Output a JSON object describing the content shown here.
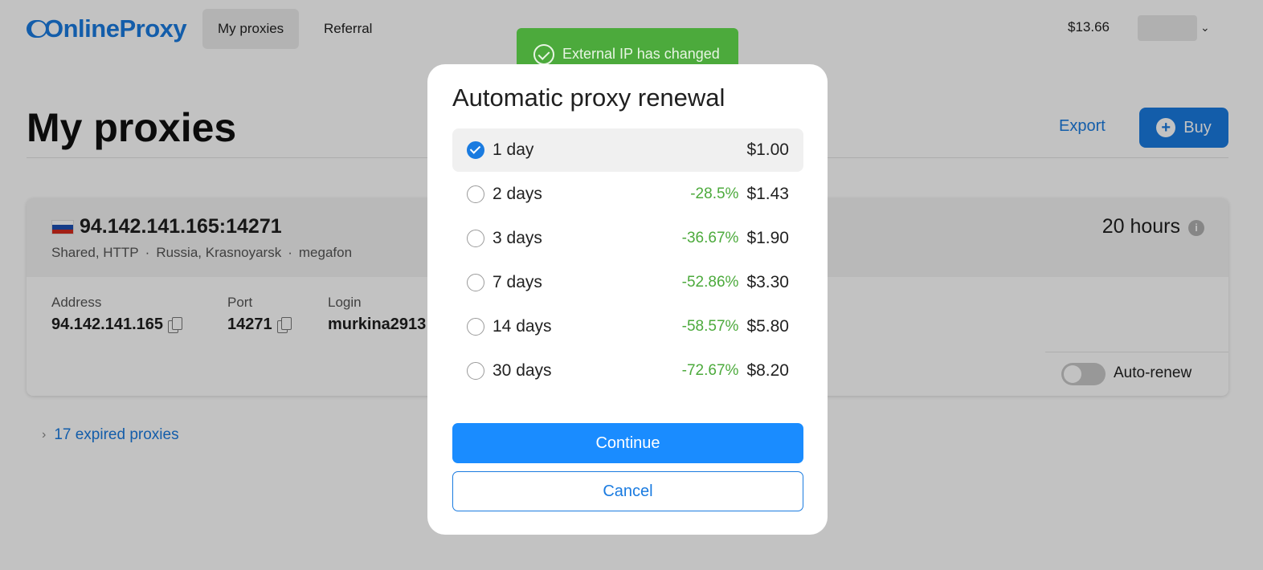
{
  "header": {
    "logo_text": "OnlineProxy",
    "nav": [
      {
        "label": "My proxies",
        "active": true
      },
      {
        "label": "Referral",
        "active": false
      }
    ],
    "balance": "$13.66",
    "user_menu_icon": "chevron-down-icon"
  },
  "page": {
    "title": "My proxies",
    "export_label": "Export",
    "buy_label": "Buy"
  },
  "proxy": {
    "address_port": "94.142.141.165:14271",
    "country_flag": "flag-russia",
    "meta": [
      "Shared, HTTP",
      "Russia, Krasnoyarsk",
      "megafon"
    ],
    "time_left": "20 hours",
    "fields": [
      {
        "label": "Address",
        "value": "94.142.141.165",
        "copyable": true
      },
      {
        "label": "Port",
        "value": "14271",
        "copyable": true
      },
      {
        "label": "Login",
        "value": "murkina2913",
        "copyable": false
      }
    ],
    "auto_renew_label": "Auto-renew",
    "auto_renew_on": false
  },
  "expired": {
    "label": "17 expired proxies"
  },
  "toast": {
    "message": "External IP has changed",
    "color": "#4caa3c"
  },
  "modal": {
    "title": "Automatic proxy renewal",
    "options": [
      {
        "label": "1 day",
        "discount": "",
        "price": "$1.00",
        "selected": true
      },
      {
        "label": "2 days",
        "discount": "-28.5%",
        "price": "$1.43",
        "selected": false
      },
      {
        "label": "3 days",
        "discount": "-36.67%",
        "price": "$1.90",
        "selected": false
      },
      {
        "label": "7 days",
        "discount": "-52.86%",
        "price": "$3.30",
        "selected": false
      },
      {
        "label": "14 days",
        "discount": "-58.57%",
        "price": "$5.80",
        "selected": false
      },
      {
        "label": "30 days",
        "discount": "-72.67%",
        "price": "$8.20",
        "selected": false
      }
    ],
    "continue_label": "Continue",
    "cancel_label": "Cancel"
  },
  "colors": {
    "accent": "#1a7be0",
    "discount": "#4caa3c"
  }
}
